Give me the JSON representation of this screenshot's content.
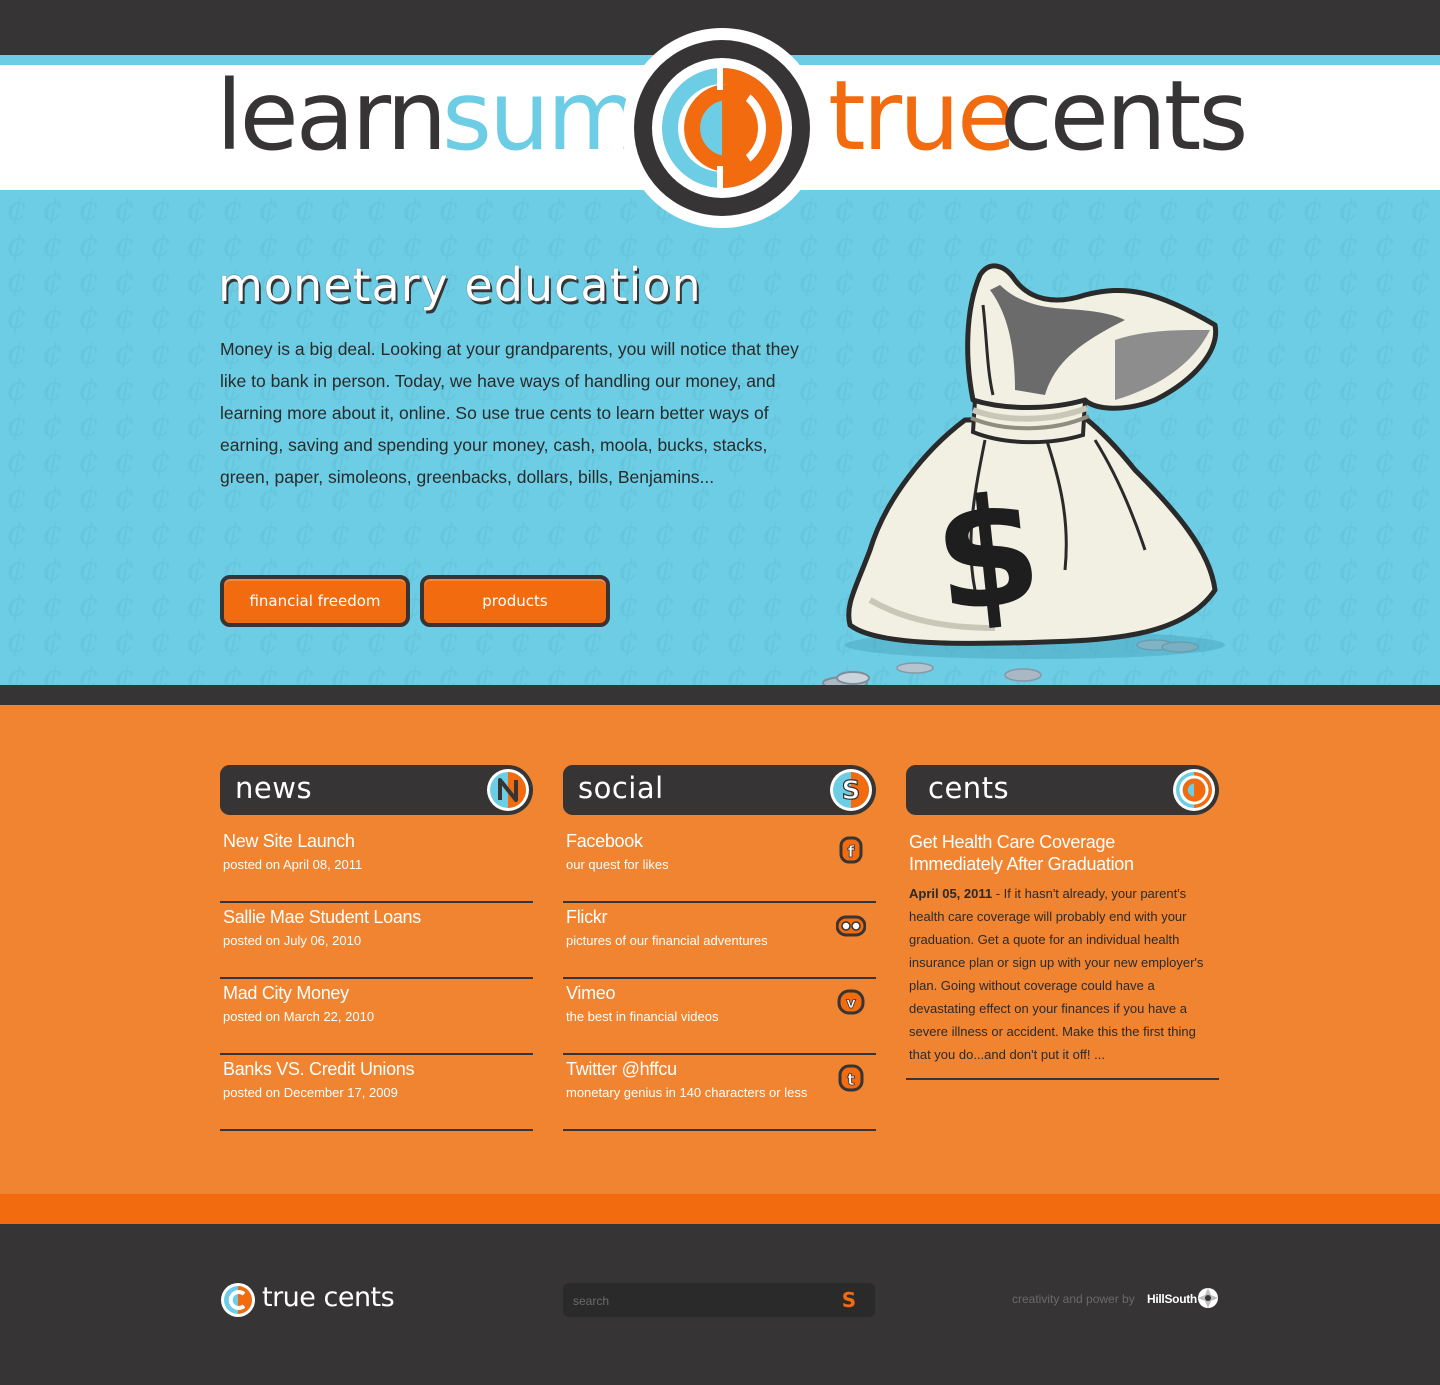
{
  "header": {
    "logo_words": {
      "learn": "learn",
      "sum": "sum",
      "true": "true",
      "cents": "cents"
    },
    "colors": {
      "dark": "#363435",
      "blue": "#6ccde5",
      "orange": "#f26b0f"
    }
  },
  "hero": {
    "title": "monetary education",
    "body": "Money is a big deal. Looking at your grandparents, you will notice that they like to bank in person. Today, we have ways of handling our money, and learning more about it, online. So use true cents to learn better ways of earning, saving and spending your money, cash, moola, bucks, stacks, green, paper, simoleons, greenbacks, dollars, bills, Benjamins...",
    "buttons": {
      "financial_freedom": "financial freedom",
      "products": "products"
    },
    "image_icon": "money-bag-icon"
  },
  "news": {
    "title": "news",
    "icon": "news-n-icon",
    "items": [
      {
        "title": "New Site Launch",
        "date": "posted on April 08, 2011"
      },
      {
        "title": "Sallie Mae Student Loans",
        "date": "posted on July 06, 2010"
      },
      {
        "title": "Mad City Money",
        "date": "posted on March 22, 2010"
      },
      {
        "title": "Banks VS. Credit Unions",
        "date": "posted on December 17, 2009"
      }
    ]
  },
  "social": {
    "title": "social",
    "icon": "social-s-icon",
    "items": [
      {
        "title": "Facebook",
        "desc": "our quest for likes",
        "icon": "facebook-icon"
      },
      {
        "title": "Flickr",
        "desc": "pictures of our financial adventures",
        "icon": "flickr-icon"
      },
      {
        "title": "Vimeo",
        "desc": "the best in financial videos",
        "icon": "vimeo-icon"
      },
      {
        "title": "Twitter @hffcu",
        "desc": "monetary genius in 140 characters or less",
        "icon": "twitter-icon"
      }
    ]
  },
  "cents": {
    "title": "cents",
    "icon": "cents-c-icon",
    "article_title": "Get Health Care Coverage Immediately After Graduation",
    "date": "April 05, 2011",
    "body": " - If it hasn't already, your parent's health care coverage will probably end with your graduation. Get a quote for an individual health insurance plan or sign up with your new employer's plan. Going without coverage could have a devastating effect on your finances if you have a severe illness or accident. Make this the first thing that you do...and don't put it off! ..."
  },
  "footer": {
    "brand": "true cents",
    "search_placeholder": "search",
    "credit": "creativity and power by",
    "company": "HillSouth"
  }
}
